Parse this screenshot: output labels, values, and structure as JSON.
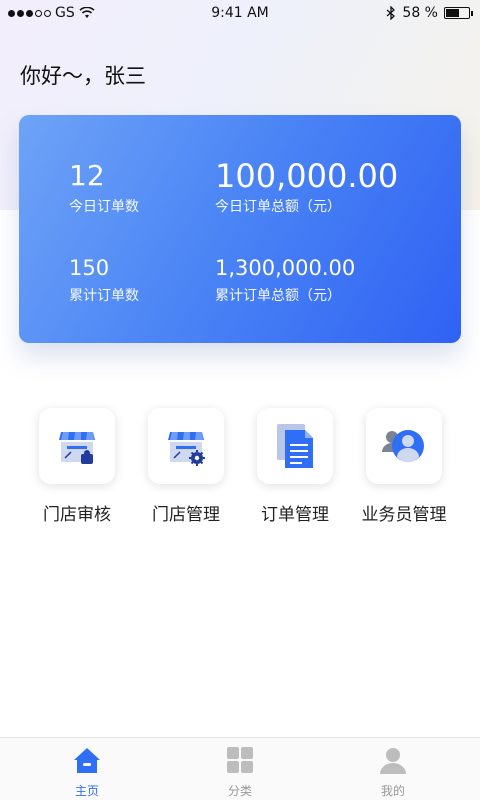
{
  "status_bar": {
    "carrier": "GS",
    "time": "9:41 AM",
    "battery": "58 %",
    "battery_level": 0.58
  },
  "greeting": "你好～，张三",
  "stats": {
    "today_orders": {
      "value": "12",
      "label": "今日订单数"
    },
    "today_amount": {
      "value": "100,000.00",
      "label": "今日订单总额（元）"
    },
    "total_orders": {
      "value": "150",
      "label": "累计订单数"
    },
    "total_amount": {
      "value": "1,300,000.00",
      "label": "累计订单总额（元）"
    }
  },
  "menu": [
    {
      "label": "门店审核",
      "icon": "store-review-icon"
    },
    {
      "label": "门店管理",
      "icon": "store-settings-icon"
    },
    {
      "label": "订单管理",
      "icon": "document-icon"
    },
    {
      "label": "业务员管理",
      "icon": "users-icon"
    }
  ],
  "tabbar": [
    {
      "label": "主页",
      "icon": "home-icon",
      "active": true
    },
    {
      "label": "分类",
      "icon": "grid-icon",
      "active": false
    },
    {
      "label": "我的",
      "icon": "user-icon",
      "active": false
    }
  ],
  "colors": {
    "accent": "#2f6ff6",
    "card_start": "#6ea3f7",
    "card_end": "#2f62f4",
    "tab_inactive": "#999999"
  }
}
